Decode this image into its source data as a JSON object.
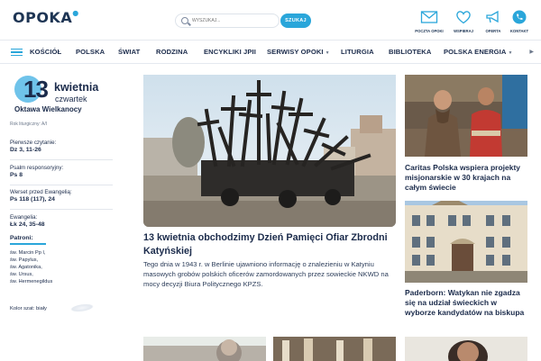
{
  "header": {
    "logo_text": "OPOKA",
    "search_placeholder": "WYSZUKAJ...",
    "search_button": "SZUKAJ",
    "icons": [
      {
        "name": "mail-icon",
        "label": "POCZTA OPOKI"
      },
      {
        "name": "heart-icon",
        "label": "WSPIERAJ"
      },
      {
        "name": "megaphone-icon",
        "label": "OFERTA"
      },
      {
        "name": "phone-icon",
        "label": "KONTAKT"
      }
    ]
  },
  "nav": {
    "items": [
      "KOŚCIÓŁ",
      "POLSKA",
      "ŚWIAT",
      "RODZINA",
      "ENCYKLIKI JPII",
      "SERWISY OPOKI",
      "LITURGIA",
      "BIBLIOTEKA",
      "POLSKA ENERGIA"
    ]
  },
  "calendar": {
    "day": "13",
    "month": "kwietnia",
    "weekday": "czwartek",
    "octave": "Oktawa Wielkanocy",
    "liturgical_year": "Rok liturgiczny: A/I",
    "readings": [
      {
        "label": "Pierwsze czytanie:",
        "value": "Dz 3, 11-26"
      },
      {
        "label": "Psalm responsoryjny:",
        "value": "Ps 8"
      },
      {
        "label": "Werset przed Ewangelią:",
        "value": "Ps 118 (117), 24"
      },
      {
        "label": "Ewangelia:",
        "value": "Łk 24, 35-48"
      }
    ],
    "patrons_title": "Patroni:",
    "patrons": [
      "św. Marcin Pp I,",
      "św. Papylus,",
      "św. Agatonika,",
      "św. Ursus,",
      "św. Hermenegildus"
    ],
    "vestment_color": "Kolor szat: biały"
  },
  "feature": {
    "title": "13 kwietnia obchodzimy Dzień Pamięci Ofiar Zbrodni Katyńskiej",
    "lead": "Tego dnia w 1943 r. w Berlinie ujawniono informację o znalezieniu w Katyniu masowych grobów polskich oficerów zamordowanych przez sowieckie NKWD na mocy decyzji Biura Politycznego KPZS."
  },
  "side_articles": [
    {
      "title": "Caritas Polska wspiera projekty misjonarskie w 30 krajach na całym świecie"
    },
    {
      "title": "Paderborn: Watykan nie zgadza się na udział świeckich w wyborze kandydatów na biskupa"
    }
  ],
  "colors": {
    "accent": "#2aa6da",
    "navy": "#1b2b4b",
    "date_circle": "#6fc3ea"
  }
}
